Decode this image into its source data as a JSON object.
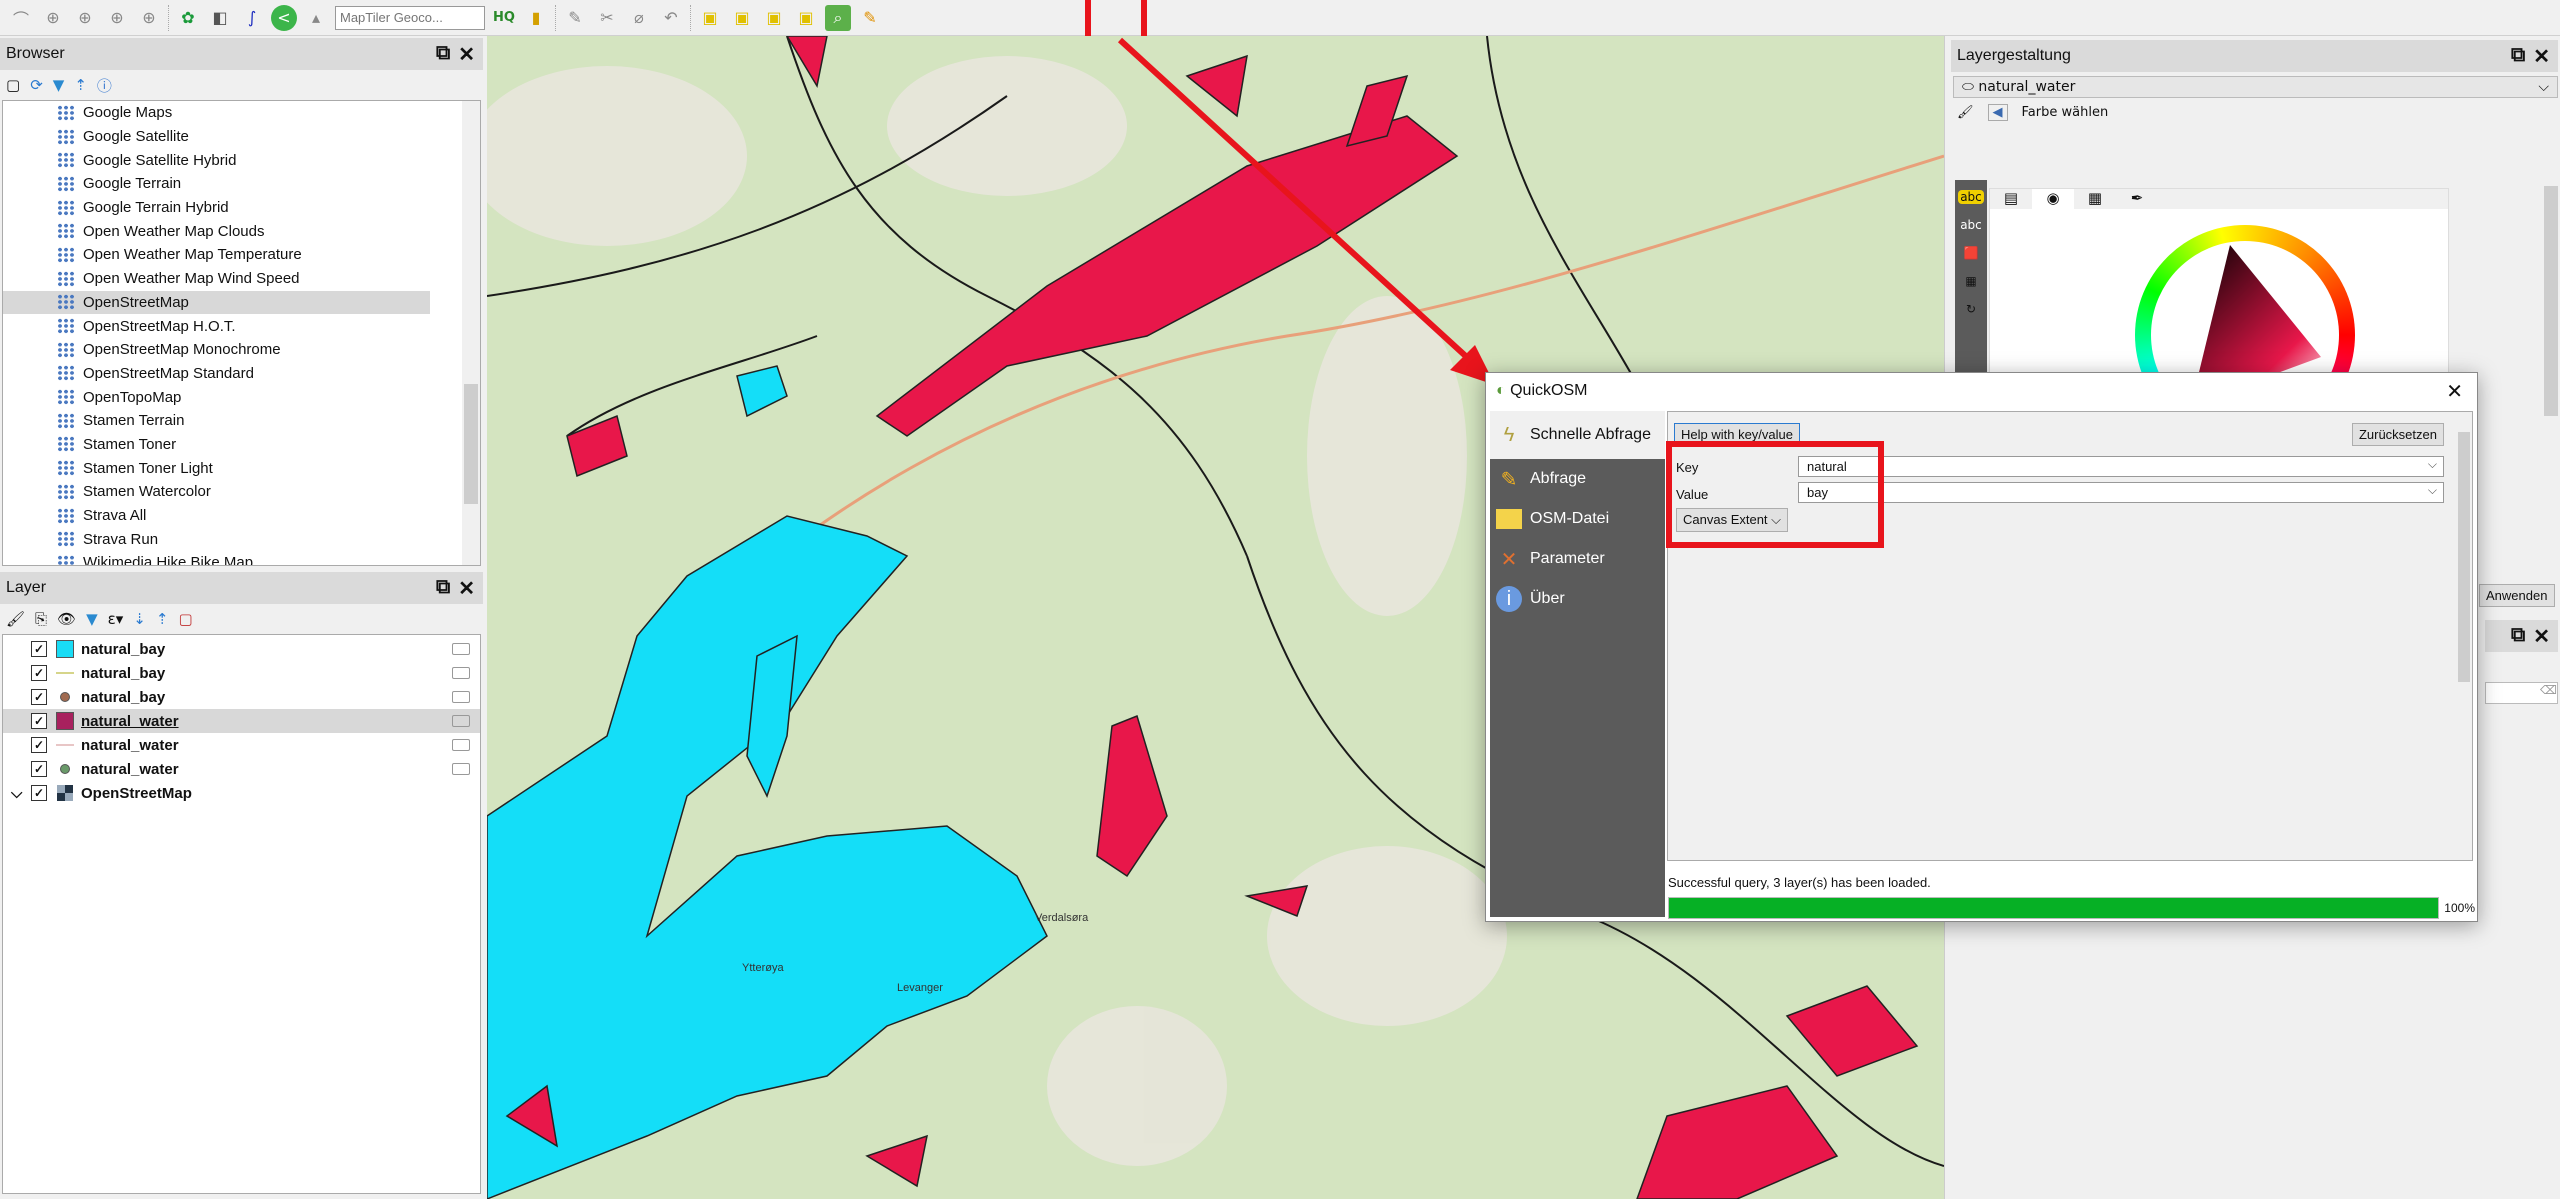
{
  "toolbar": {
    "geocoder_placeholder": "MapTiler Geoco...",
    "icons": [
      "digitize-icon",
      "add-layer-icon",
      "add-layer-icon",
      "add-layer-icon",
      "add-layer-icon",
      "plugin-icon",
      "eraser-icon",
      "curve-icon",
      "share-icon",
      "chart-icon",
      "hq-icon",
      "db-icon",
      "edit-icon",
      "select-icon",
      "select-icon",
      "deselect-icon",
      "select-icon",
      "quickosm-icon",
      "pencil-icon"
    ]
  },
  "browser": {
    "title": "Browser",
    "items": [
      "Google Maps",
      "Google Satellite",
      "Google Satellite Hybrid",
      "Google Terrain",
      "Google Terrain Hybrid",
      "Open Weather Map Clouds",
      "Open Weather Map Temperature",
      "Open Weather Map Wind Speed",
      "OpenStreetMap",
      "OpenStreetMap H.O.T.",
      "OpenStreetMap Monochrome",
      "OpenStreetMap Standard",
      "OpenTopoMap",
      "Stamen Terrain",
      "Stamen Toner",
      "Stamen Toner Light",
      "Stamen Watercolor",
      "Strava All",
      "Strava Run",
      "Wikimedia Hike Bike Map"
    ],
    "selected": "OpenStreetMap"
  },
  "layers": {
    "title": "Layer",
    "items": [
      {
        "name": "natural_bay",
        "symbol": "polygon",
        "color": "#19dcf5",
        "checked": true
      },
      {
        "name": "natural_bay",
        "symbol": "line",
        "color": "#d6d58a",
        "checked": true
      },
      {
        "name": "natural_bay",
        "symbol": "point",
        "color": "#a06a50",
        "checked": true
      },
      {
        "name": "natural_water",
        "symbol": "polygon",
        "color": "#a8215e",
        "checked": true,
        "selected": true
      },
      {
        "name": "natural_water",
        "symbol": "line",
        "color": "#e8c6c6",
        "checked": true
      },
      {
        "name": "natural_water",
        "symbol": "point",
        "color": "#6a9a6a",
        "checked": true
      },
      {
        "name": "OpenStreetMap",
        "symbol": "raster",
        "checked": true
      }
    ]
  },
  "map": {
    "labels": [
      "Verdalsøra",
      "Ytterøya",
      "Levanger"
    ],
    "colors": {
      "background": "#d4e4c0",
      "bay": "#14def8",
      "water": "#e8174a"
    }
  },
  "style_panel": {
    "title": "Layergestaltung",
    "layer": "natural_water",
    "section": "Farbe wählen",
    "apply": "Anwenden"
  },
  "dialog": {
    "title": "QuickOSM",
    "nav": [
      "Schnelle Abfrage",
      "Abfrage",
      "OSM-Datei",
      "Parameter",
      "Über"
    ],
    "active": "Schnelle Abfrage",
    "help_button": "Help with key/value",
    "reset_button": "Zurücksetzen",
    "key_label": "Key",
    "key_value": "natural",
    "value_label": "Value",
    "value_value": "bay",
    "extent": "Canvas Extent",
    "status": "Successful query, 3 layer(s) has been loaded.",
    "progress": 100,
    "progress_text": "100%",
    "progress_color": "#06b025"
  },
  "annotation_color": "#e8141c"
}
